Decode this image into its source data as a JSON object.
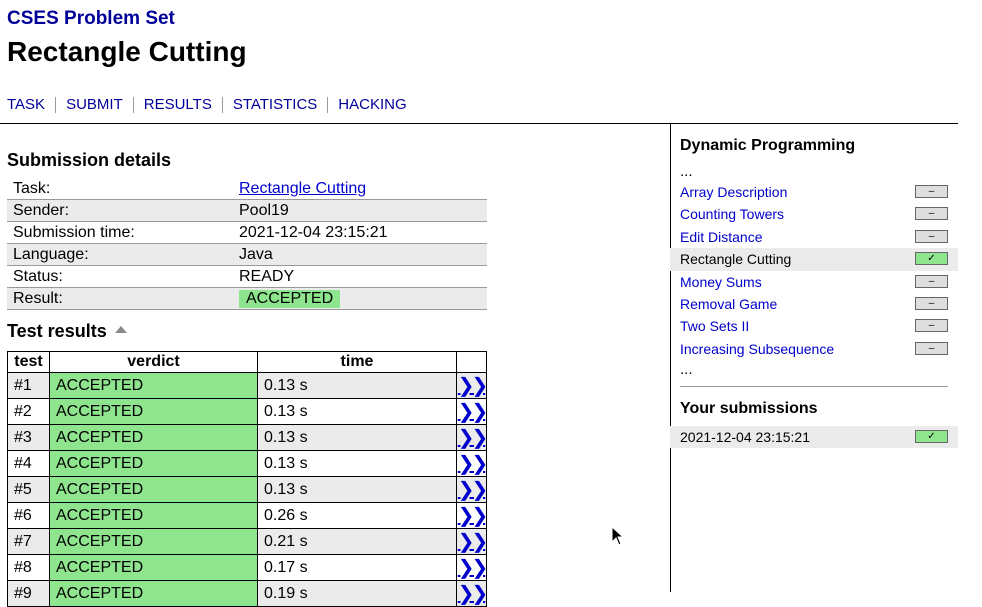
{
  "site_title": "CSES Problem Set",
  "page_title": "Rectangle Cutting",
  "nav": [
    "TASK",
    "SUBMIT",
    "RESULTS",
    "STATISTICS",
    "HACKING"
  ],
  "submission": {
    "heading": "Submission details",
    "rows": [
      {
        "label": "Task:",
        "value": "Rectangle Cutting",
        "link": true
      },
      {
        "label": "Sender:",
        "value": "Pool19"
      },
      {
        "label": "Submission time:",
        "value": "2021-12-04 23:15:21"
      },
      {
        "label": "Language:",
        "value": "Java"
      },
      {
        "label": "Status:",
        "value": "READY"
      },
      {
        "label": "Result:",
        "value": "ACCEPTED",
        "badge": true
      }
    ]
  },
  "tests": {
    "heading": "Test results",
    "columns": [
      "test",
      "verdict",
      "time",
      ""
    ],
    "link_icon": "double-chevron-right",
    "rows": [
      {
        "test": "#1",
        "verdict": "ACCEPTED",
        "time": "0.13 s"
      },
      {
        "test": "#2",
        "verdict": "ACCEPTED",
        "time": "0.13 s"
      },
      {
        "test": "#3",
        "verdict": "ACCEPTED",
        "time": "0.13 s"
      },
      {
        "test": "#4",
        "verdict": "ACCEPTED",
        "time": "0.13 s"
      },
      {
        "test": "#5",
        "verdict": "ACCEPTED",
        "time": "0.13 s"
      },
      {
        "test": "#6",
        "verdict": "ACCEPTED",
        "time": "0.26 s"
      },
      {
        "test": "#7",
        "verdict": "ACCEPTED",
        "time": "0.21 s"
      },
      {
        "test": "#8",
        "verdict": "ACCEPTED",
        "time": "0.17 s"
      },
      {
        "test": "#9",
        "verdict": "ACCEPTED",
        "time": "0.19 s"
      }
    ]
  },
  "sidebar": {
    "category": "Dynamic Programming",
    "ellipsis": "...",
    "problems": [
      {
        "name": "Array Description",
        "status": "–"
      },
      {
        "name": "Counting Towers",
        "status": "–"
      },
      {
        "name": "Edit Distance",
        "status": "–"
      },
      {
        "name": "Rectangle Cutting",
        "status": "✓",
        "current": true
      },
      {
        "name": "Money Sums",
        "status": "–"
      },
      {
        "name": "Removal Game",
        "status": "–"
      },
      {
        "name": "Two Sets II",
        "status": "–"
      },
      {
        "name": "Increasing Subsequence",
        "status": "–"
      }
    ],
    "your_submissions_heading": "Your submissions",
    "submissions": [
      {
        "time": "2021-12-04 23:15:21",
        "status": "✓"
      }
    ]
  },
  "colors": {
    "accepted": "#8ee58e",
    "link": "#0000cc",
    "title": "#000099",
    "row_alt": "#ebebeb"
  }
}
